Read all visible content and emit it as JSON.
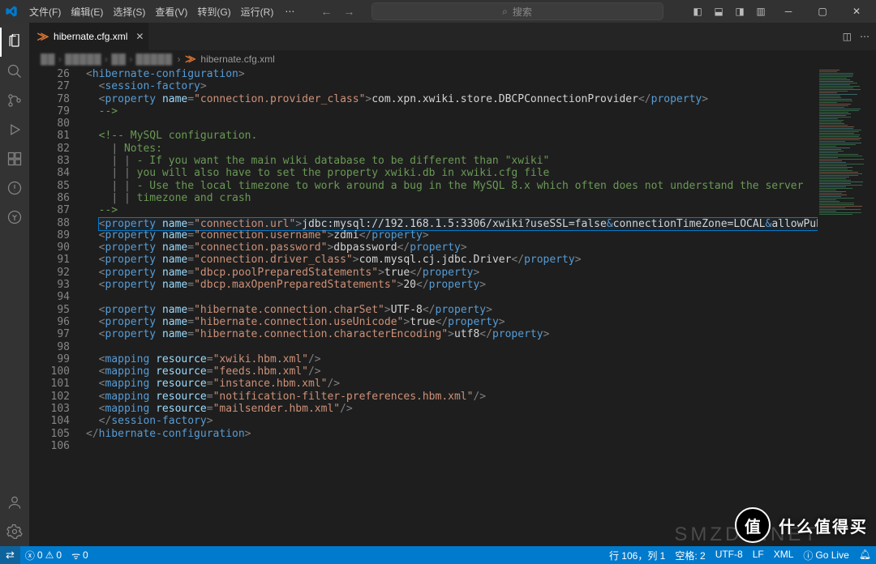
{
  "menu": [
    "文件(F)",
    "编辑(E)",
    "选择(S)",
    "查看(V)",
    "转到(G)",
    "运行(R)"
  ],
  "search_placeholder": "搜索",
  "tab": {
    "filename": "hibernate.cfg.xml"
  },
  "breadcrumb_tail": "hibernate.cfg.xml",
  "line_numbers": [
    26,
    27,
    78,
    79,
    80,
    81,
    82,
    83,
    84,
    85,
    86,
    87,
    88,
    89,
    90,
    91,
    92,
    93,
    94,
    95,
    96,
    97,
    98,
    99,
    100,
    101,
    102,
    103,
    104,
    105,
    106
  ],
  "code_lines": [
    {
      "indent": 0,
      "type": "open",
      "tag": "hibernate-configuration"
    },
    {
      "indent": 1,
      "type": "open",
      "tag": "session-factory"
    },
    {
      "indent": 1,
      "type": "prop",
      "attr": "connection.provider_class",
      "text": "com.xpn.xwiki.store.DBCPConnectionProvider"
    },
    {
      "indent": 1,
      "type": "comment",
      "text": "-->"
    },
    {
      "indent": 0,
      "type": "blank"
    },
    {
      "indent": 1,
      "type": "comment",
      "text": "<!-- MySQL configuration."
    },
    {
      "indent": 1,
      "type": "comment",
      "bar": 1,
      "text": "Notes:"
    },
    {
      "indent": 1,
      "type": "comment",
      "bar": 2,
      "text": "- If you want the main wiki database to be different than \"xwiki\""
    },
    {
      "indent": 1,
      "type": "comment",
      "bar": 2,
      "text": "you will also have to set the property xwiki.db in xwiki.cfg file"
    },
    {
      "indent": 1,
      "type": "comment",
      "bar": 2,
      "text": "- Use the local timezone to work around a bug in the MySQL 8.x which often does not understand the server"
    },
    {
      "indent": 1,
      "type": "comment",
      "bar": 2,
      "text": "timezone and crash"
    },
    {
      "indent": 1,
      "type": "comment",
      "text": "-->"
    },
    {
      "indent": 1,
      "type": "prop",
      "hl": true,
      "attr": "connection.url",
      "parts": [
        {
          "t": "tx",
          "v": "jdbc:mysql://192.168.1.5:3306/xwiki?useSSL=false"
        },
        {
          "t": "ent",
          "v": "&amp;"
        },
        {
          "t": "tx",
          "v": "connectionTimeZone=LOCAL"
        },
        {
          "t": "ent",
          "v": "&amp;"
        },
        {
          "t": "tx",
          "v": "allowPublicKeyRetrieval=true"
        }
      ]
    },
    {
      "indent": 1,
      "type": "prop",
      "attr": "connection.username",
      "text": "zdmi"
    },
    {
      "indent": 1,
      "type": "prop",
      "attr": "connection.password",
      "text": "dbpassword"
    },
    {
      "indent": 1,
      "type": "prop",
      "attr": "connection.driver_class",
      "text": "com.mysql.cj.jdbc.Driver"
    },
    {
      "indent": 1,
      "type": "prop",
      "attr": "dbcp.poolPreparedStatements",
      "text": "true"
    },
    {
      "indent": 1,
      "type": "prop",
      "attr": "dbcp.maxOpenPreparedStatements",
      "text": "20"
    },
    {
      "indent": 0,
      "type": "blank"
    },
    {
      "indent": 1,
      "type": "prop",
      "attr": "hibernate.connection.charSet",
      "text": "UTF-8"
    },
    {
      "indent": 1,
      "type": "prop",
      "attr": "hibernate.connection.useUnicode",
      "text": "true"
    },
    {
      "indent": 1,
      "type": "prop",
      "attr": "hibernate.connection.characterEncoding",
      "text": "utf8"
    },
    {
      "indent": 0,
      "type": "blank"
    },
    {
      "indent": 1,
      "type": "map",
      "res": "xwiki.hbm.xml"
    },
    {
      "indent": 1,
      "type": "map",
      "res": "feeds.hbm.xml"
    },
    {
      "indent": 1,
      "type": "map",
      "res": "instance.hbm.xml"
    },
    {
      "indent": 1,
      "type": "map",
      "res": "notification-filter-preferences.hbm.xml"
    },
    {
      "indent": 1,
      "type": "map",
      "res": "mailsender.hbm.xml"
    },
    {
      "indent": 1,
      "type": "close",
      "tag": "session-factory"
    },
    {
      "indent": 0,
      "type": "close",
      "tag": "hibernate-configuration"
    },
    {
      "indent": 0,
      "type": "blank"
    }
  ],
  "status": {
    "errors": "0",
    "warnings": "0",
    "ports": "0",
    "cursor": "行 106，列 1",
    "spaces": "空格: 2",
    "encoding": "UTF-8",
    "eol": "LF",
    "lang": "XML",
    "golive": "Go Live",
    "bell": ""
  },
  "watermark": {
    "badge": "值",
    "text": "什么值得买"
  }
}
